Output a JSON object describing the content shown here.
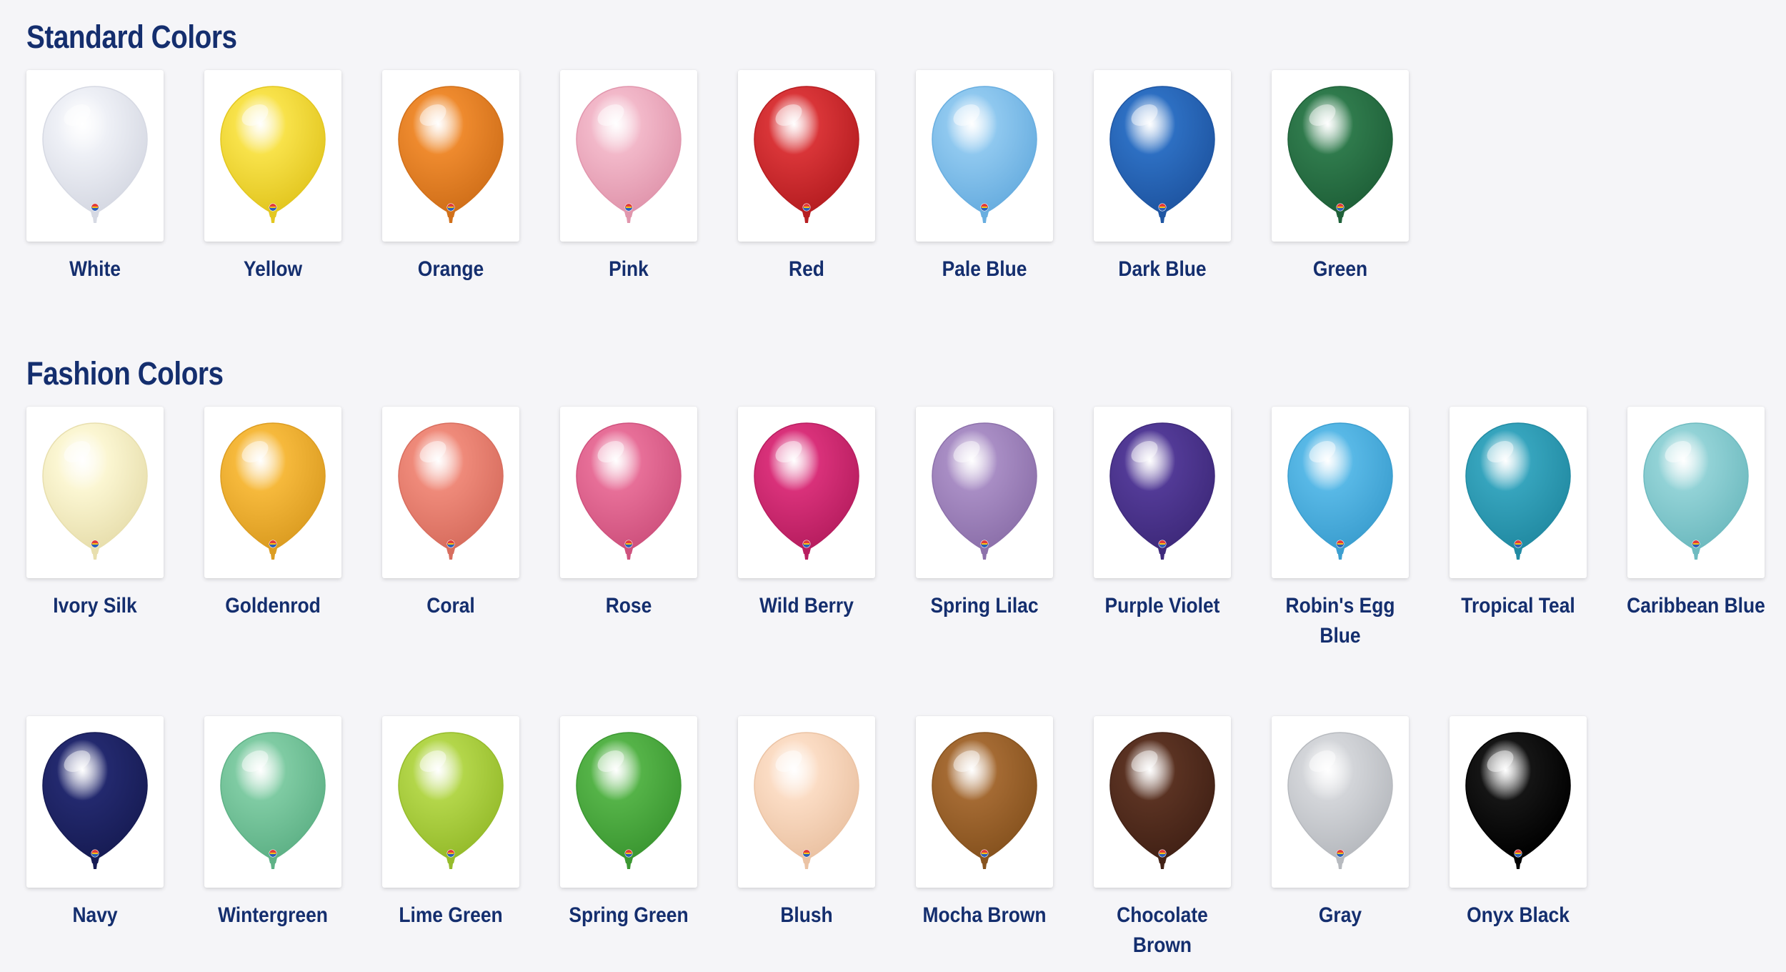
{
  "sections": [
    {
      "title": "Standard Colors",
      "rows": [
        [
          {
            "label": "White",
            "color": "#eef0f6",
            "edge": "#d6d9e3"
          },
          {
            "label": "Yellow",
            "color": "#f8e24a",
            "edge": "#e3c721"
          },
          {
            "label": "Orange",
            "color": "#ee8a2e",
            "edge": "#d1701a"
          },
          {
            "label": "Pink",
            "color": "#f2b8c9",
            "edge": "#e196ad"
          },
          {
            "label": "Red",
            "color": "#d93538",
            "edge": "#b71e22"
          },
          {
            "label": "Pale Blue",
            "color": "#8fc8ef",
            "edge": "#69aee0"
          },
          {
            "label": "Dark Blue",
            "color": "#2d6fc2",
            "edge": "#1f56a3"
          },
          {
            "label": "Green",
            "color": "#2f7a4c",
            "edge": "#1f6139"
          }
        ]
      ]
    },
    {
      "title": "Fashion Colors",
      "rows": [
        [
          {
            "label": "Ivory Silk",
            "color": "#fbf6d2",
            "edge": "#e8dfae"
          },
          {
            "label": "Goldenrod",
            "color": "#f6b93c",
            "edge": "#dc9d22"
          },
          {
            "label": "Coral",
            "color": "#ef8a7a",
            "edge": "#d86e5f"
          },
          {
            "label": "Rose",
            "color": "#e76f98",
            "edge": "#cf527e"
          },
          {
            "label": "Wild Berry",
            "color": "#d9317a",
            "edge": "#b81e60"
          },
          {
            "label": "Spring Lilac",
            "color": "#a88dc4",
            "edge": "#8d71ab"
          },
          {
            "label": "Purple Violet",
            "color": "#523a96",
            "edge": "#3f2a7c"
          },
          {
            "label": "Robin's Egg Blue",
            "color": "#58b8e6",
            "edge": "#3c9fd0"
          },
          {
            "label": "Tropical Teal",
            "color": "#36a4bd",
            "edge": "#228ba3"
          },
          {
            "label": "Caribbean Blue",
            "color": "#92d2d6",
            "edge": "#6fbbc0"
          }
        ],
        [
          {
            "label": "Navy",
            "color": "#23296e",
            "edge": "#171c55"
          },
          {
            "label": "Wintergreen",
            "color": "#7fcba3",
            "edge": "#5fb287"
          },
          {
            "label": "Lime Green",
            "color": "#b3d64a",
            "edge": "#96bc2c"
          },
          {
            "label": "Spring Green",
            "color": "#55b348",
            "edge": "#3c9832"
          },
          {
            "label": "Blush",
            "color": "#fbdcc4",
            "edge": "#ebc3a4"
          },
          {
            "label": "Mocha Brown",
            "color": "#a46a33",
            "edge": "#87531f"
          },
          {
            "label": "Chocolate Brown",
            "color": "#5a3222",
            "edge": "#432216"
          },
          {
            "label": "Gray",
            "color": "#d3d5d9",
            "edge": "#b7babf"
          },
          {
            "label": "Onyx Black",
            "color": "#151515",
            "edge": "#000000"
          }
        ]
      ]
    }
  ]
}
